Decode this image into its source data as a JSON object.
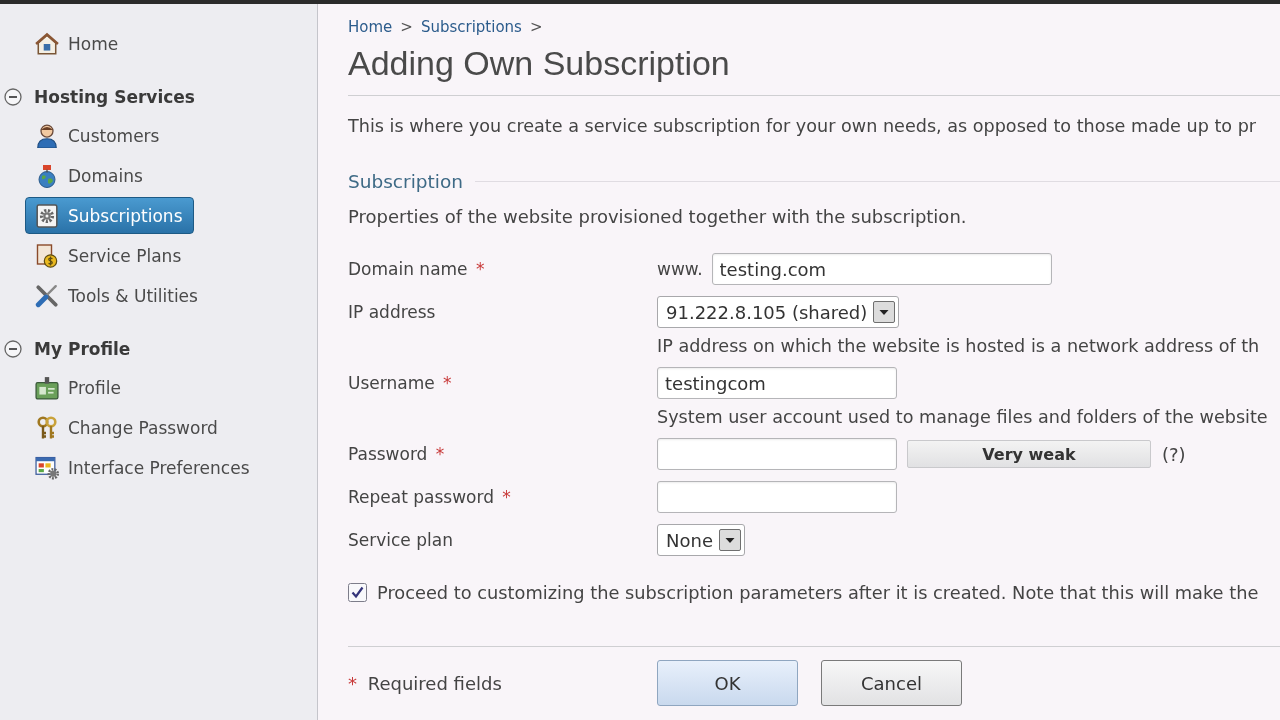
{
  "sidebar": {
    "items": [
      {
        "label": "Home",
        "selected": false
      }
    ],
    "groups": [
      {
        "label": "Hosting Services",
        "expanded": true,
        "items": [
          {
            "label": "Customers",
            "selected": false
          },
          {
            "label": "Domains",
            "selected": false
          },
          {
            "label": "Subscriptions",
            "selected": true
          },
          {
            "label": "Service Plans",
            "selected": false
          },
          {
            "label": "Tools & Utilities",
            "selected": false
          }
        ]
      },
      {
        "label": "My Profile",
        "expanded": true,
        "items": [
          {
            "label": "Profile",
            "selected": false
          },
          {
            "label": "Change Password",
            "selected": false
          },
          {
            "label": "Interface Preferences",
            "selected": false
          }
        ]
      }
    ]
  },
  "breadcrumb": [
    {
      "label": "Home",
      "separator": ">"
    },
    {
      "label": "Subscriptions",
      "separator": ">"
    }
  ],
  "title": "Adding Own Subscription",
  "description": "This is where you create a service subscription for your own needs, as opposed to those made up to pr",
  "section": {
    "title": "Subscription",
    "description": "Properties of the website provisioned together with the subscription."
  },
  "fields": [
    {
      "kind": "text",
      "label": "Domain name",
      "required_mark": "*",
      "prefix": "www.",
      "value": "testing.com"
    },
    {
      "kind": "select",
      "label": "IP address",
      "value": "91.222.8.105 (shared)",
      "hint": "IP address on which the website is hosted is a network address of th"
    },
    {
      "kind": "text",
      "label": "Username",
      "required_mark": "*",
      "value": "testingcom",
      "hint": "System user account used to manage files and folders of the website"
    },
    {
      "kind": "password",
      "label": "Password",
      "required_mark": "*",
      "strength": "Very weak",
      "help": "(?)"
    },
    {
      "kind": "password",
      "label": "Repeat password",
      "required_mark": "*"
    },
    {
      "kind": "select",
      "label": "Service plan",
      "value": "None"
    }
  ],
  "checkbox": {
    "label": "Proceed to customizing the subscription parameters after it is created. Note that this will make the",
    "checked": true
  },
  "footer": {
    "required_note": {
      "mark": "*",
      "text": "Required fields"
    },
    "buttons": [
      {
        "label": "OK",
        "kind": "primary"
      },
      {
        "label": "Cancel",
        "kind": "secondary"
      }
    ]
  }
}
